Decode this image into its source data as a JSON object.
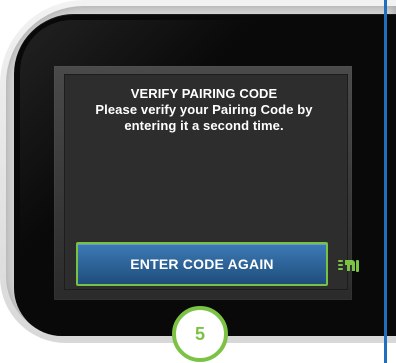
{
  "screen": {
    "title": "VERIFY PAIRING CODE",
    "message": "Please verify your Pairing Code by entering it a second time."
  },
  "actions": {
    "primary_label": "ENTER CODE AGAIN"
  },
  "step": {
    "number": "5"
  },
  "icons": {
    "tap": "hand-tap-icon"
  },
  "colors": {
    "accent_green": "#77c144",
    "button_blue_top": "#3c7bb6",
    "button_blue_bottom": "#1f4d7c",
    "screen_dark": "#2d2d2d",
    "side_divider_blue": "#1f6fbf"
  }
}
